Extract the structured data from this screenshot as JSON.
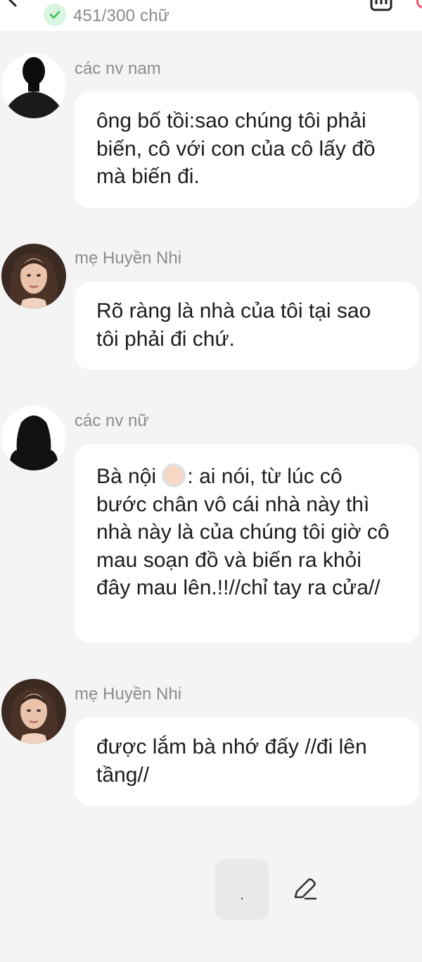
{
  "header": {
    "word_count": "451/300 chữ",
    "back_icon": "chevron-left-icon",
    "status_icon": "check-icon",
    "menu_icon": "menu-icon"
  },
  "messages": [
    {
      "sender": "các nv nam",
      "avatar": "male-silhouette",
      "text": "ông bố tồi:sao chúng tôi phải biến, cô với con của cô lấy đồ mà biến đi."
    },
    {
      "sender": "mẹ Huyền Nhi",
      "avatar": "woman-portrait",
      "text": "Rõ ràng là nhà của tôi tại sao tôi phải đi chứ."
    },
    {
      "sender": "các nv nữ",
      "avatar": "female-silhouette",
      "text_before_emoji": "Bà nội ",
      "emoji": "older-person-emoji",
      "text_after_emoji": ": ai nói, từ lúc cô bước chân vô cái nhà này thì nhà này là của chúng tôi giờ cô mau soạn đồ và biến ra khỏi đây mau lên.!!//chỉ tay ra cửa//"
    },
    {
      "sender": "mẹ Huyền Nhi",
      "avatar": "woman-portrait",
      "text": "được lắm bà nhớ đấy //đi lên tầng//"
    }
  ],
  "footer": {
    "dot_key": ".",
    "edit_icon": "pencil-icon"
  },
  "colors": {
    "background": "#f4f4f4",
    "bubble": "#ffffff",
    "check_green": "#3fbf57",
    "accent_pink": "#ff4f6d",
    "sender_gray": "#8c8c8c"
  }
}
